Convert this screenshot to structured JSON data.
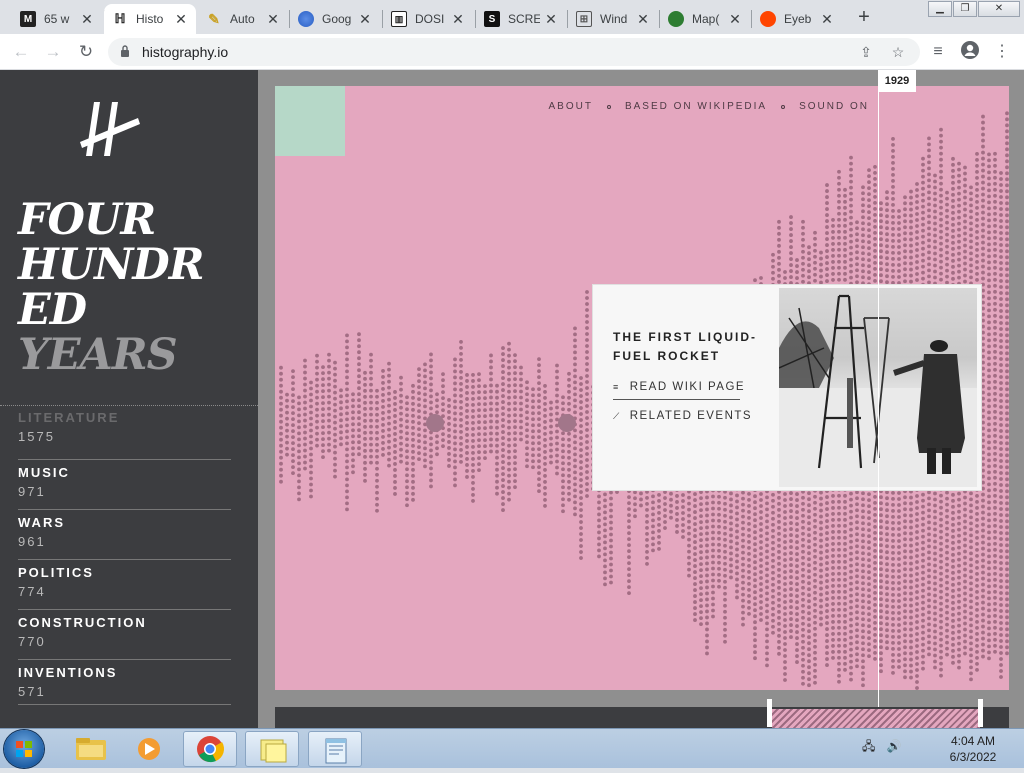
{
  "browser": {
    "tabs": [
      {
        "title": "65 w",
        "favicon": "M"
      },
      {
        "title": "Histo",
        "favicon": "H",
        "active": true
      },
      {
        "title": "Auto",
        "favicon": "A"
      },
      {
        "title": "Goog",
        "favicon": "G"
      },
      {
        "title": "DOSI",
        "favicon": "D"
      },
      {
        "title": "SCRE",
        "favicon": "S"
      },
      {
        "title": "Wind",
        "favicon": "W"
      },
      {
        "title": "Map(",
        "favicon": "M"
      },
      {
        "title": "Eyeb",
        "favicon": "R"
      }
    ],
    "url": "histography.io"
  },
  "site": {
    "title_lines": [
      "FOUR",
      "HUNDR",
      "ED"
    ],
    "title_dim": "YEARS",
    "nav": [
      "ABOUT",
      "BASED ON WIKIPEDIA",
      "SOUND ON"
    ],
    "categories": [
      {
        "name": "LITERATURE",
        "count": "1575"
      },
      {
        "name": "MUSIC",
        "count": "971"
      },
      {
        "name": "WARS",
        "count": "961"
      },
      {
        "name": "POLITICS",
        "count": "774"
      },
      {
        "name": "CONSTRUCTION",
        "count": "770"
      },
      {
        "name": "INVENTIONS",
        "count": "571"
      }
    ],
    "card": {
      "title": "THE FIRST LIQUID-FUEL ROCKET",
      "link1": "READ WIKI PAGE",
      "link2": "RELATED EVENTS"
    },
    "year": "1929"
  },
  "taskbar": {
    "time": "4:04 AM",
    "date": "6/3/2022"
  },
  "colors": {
    "background": "#e4a7bf",
    "dots": "#a36d84",
    "sidebar": "#3c3d40",
    "mint": "#b6d8c8"
  }
}
